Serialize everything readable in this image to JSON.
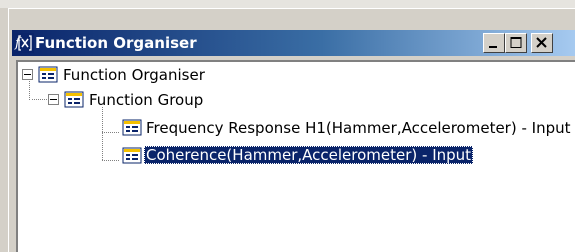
{
  "window": {
    "title": "Function Organiser",
    "controls": {
      "minimize": "_",
      "maximize": "□",
      "close": "×"
    }
  },
  "tree": {
    "root": {
      "label": "Function Organiser",
      "expanded": true,
      "children": [
        {
          "label": "Function Group",
          "expanded": true,
          "children": [
            {
              "label": "Frequency Response H1(Hammer,Accelerometer) - Input",
              "selected": false
            },
            {
              "label": "Coherence(Hammer,Accelerometer) - Input",
              "selected": true
            }
          ]
        }
      ]
    }
  },
  "colors": {
    "titlebar_start": "#0a246a",
    "titlebar_end": "#a6caf0",
    "selection": "#0a246a",
    "face": "#d4d0c8",
    "icon_accent": "#f4c000"
  },
  "icons": {
    "app": "function-organiser-icon",
    "node": "function-group-icon",
    "expander": "minus-box-icon"
  }
}
